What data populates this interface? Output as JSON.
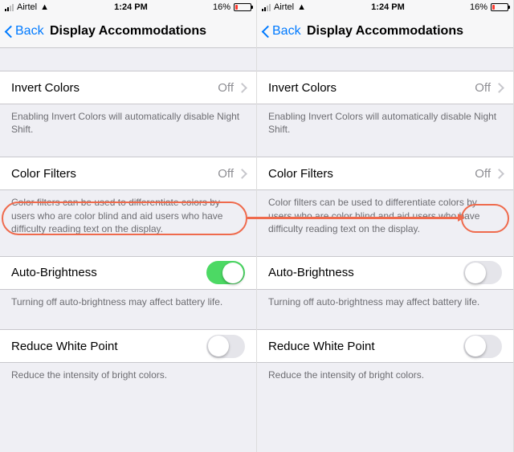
{
  "status": {
    "carrier": "Airtel",
    "time": "1:24 PM",
    "battery_pct": "16%"
  },
  "nav": {
    "back": "Back",
    "title": "Display Accommodations"
  },
  "rows": {
    "invert": {
      "label": "Invert Colors",
      "value": "Off"
    },
    "invert_note": "Enabling Invert Colors will automatically disable Night Shift.",
    "filters": {
      "label": "Color Filters",
      "value": "Off"
    },
    "filters_note": "Color filters can be used to differentiate colors by users who are color blind and aid users who have difficulty reading text on the display.",
    "auto": {
      "label": "Auto-Brightness"
    },
    "auto_note": "Turning off auto-brightness may affect battery life.",
    "rwp": {
      "label": "Reduce White Point"
    },
    "rwp_note": "Reduce the intensity of bright colors."
  },
  "left": {
    "auto_on": true
  },
  "right": {
    "auto_on": false
  }
}
